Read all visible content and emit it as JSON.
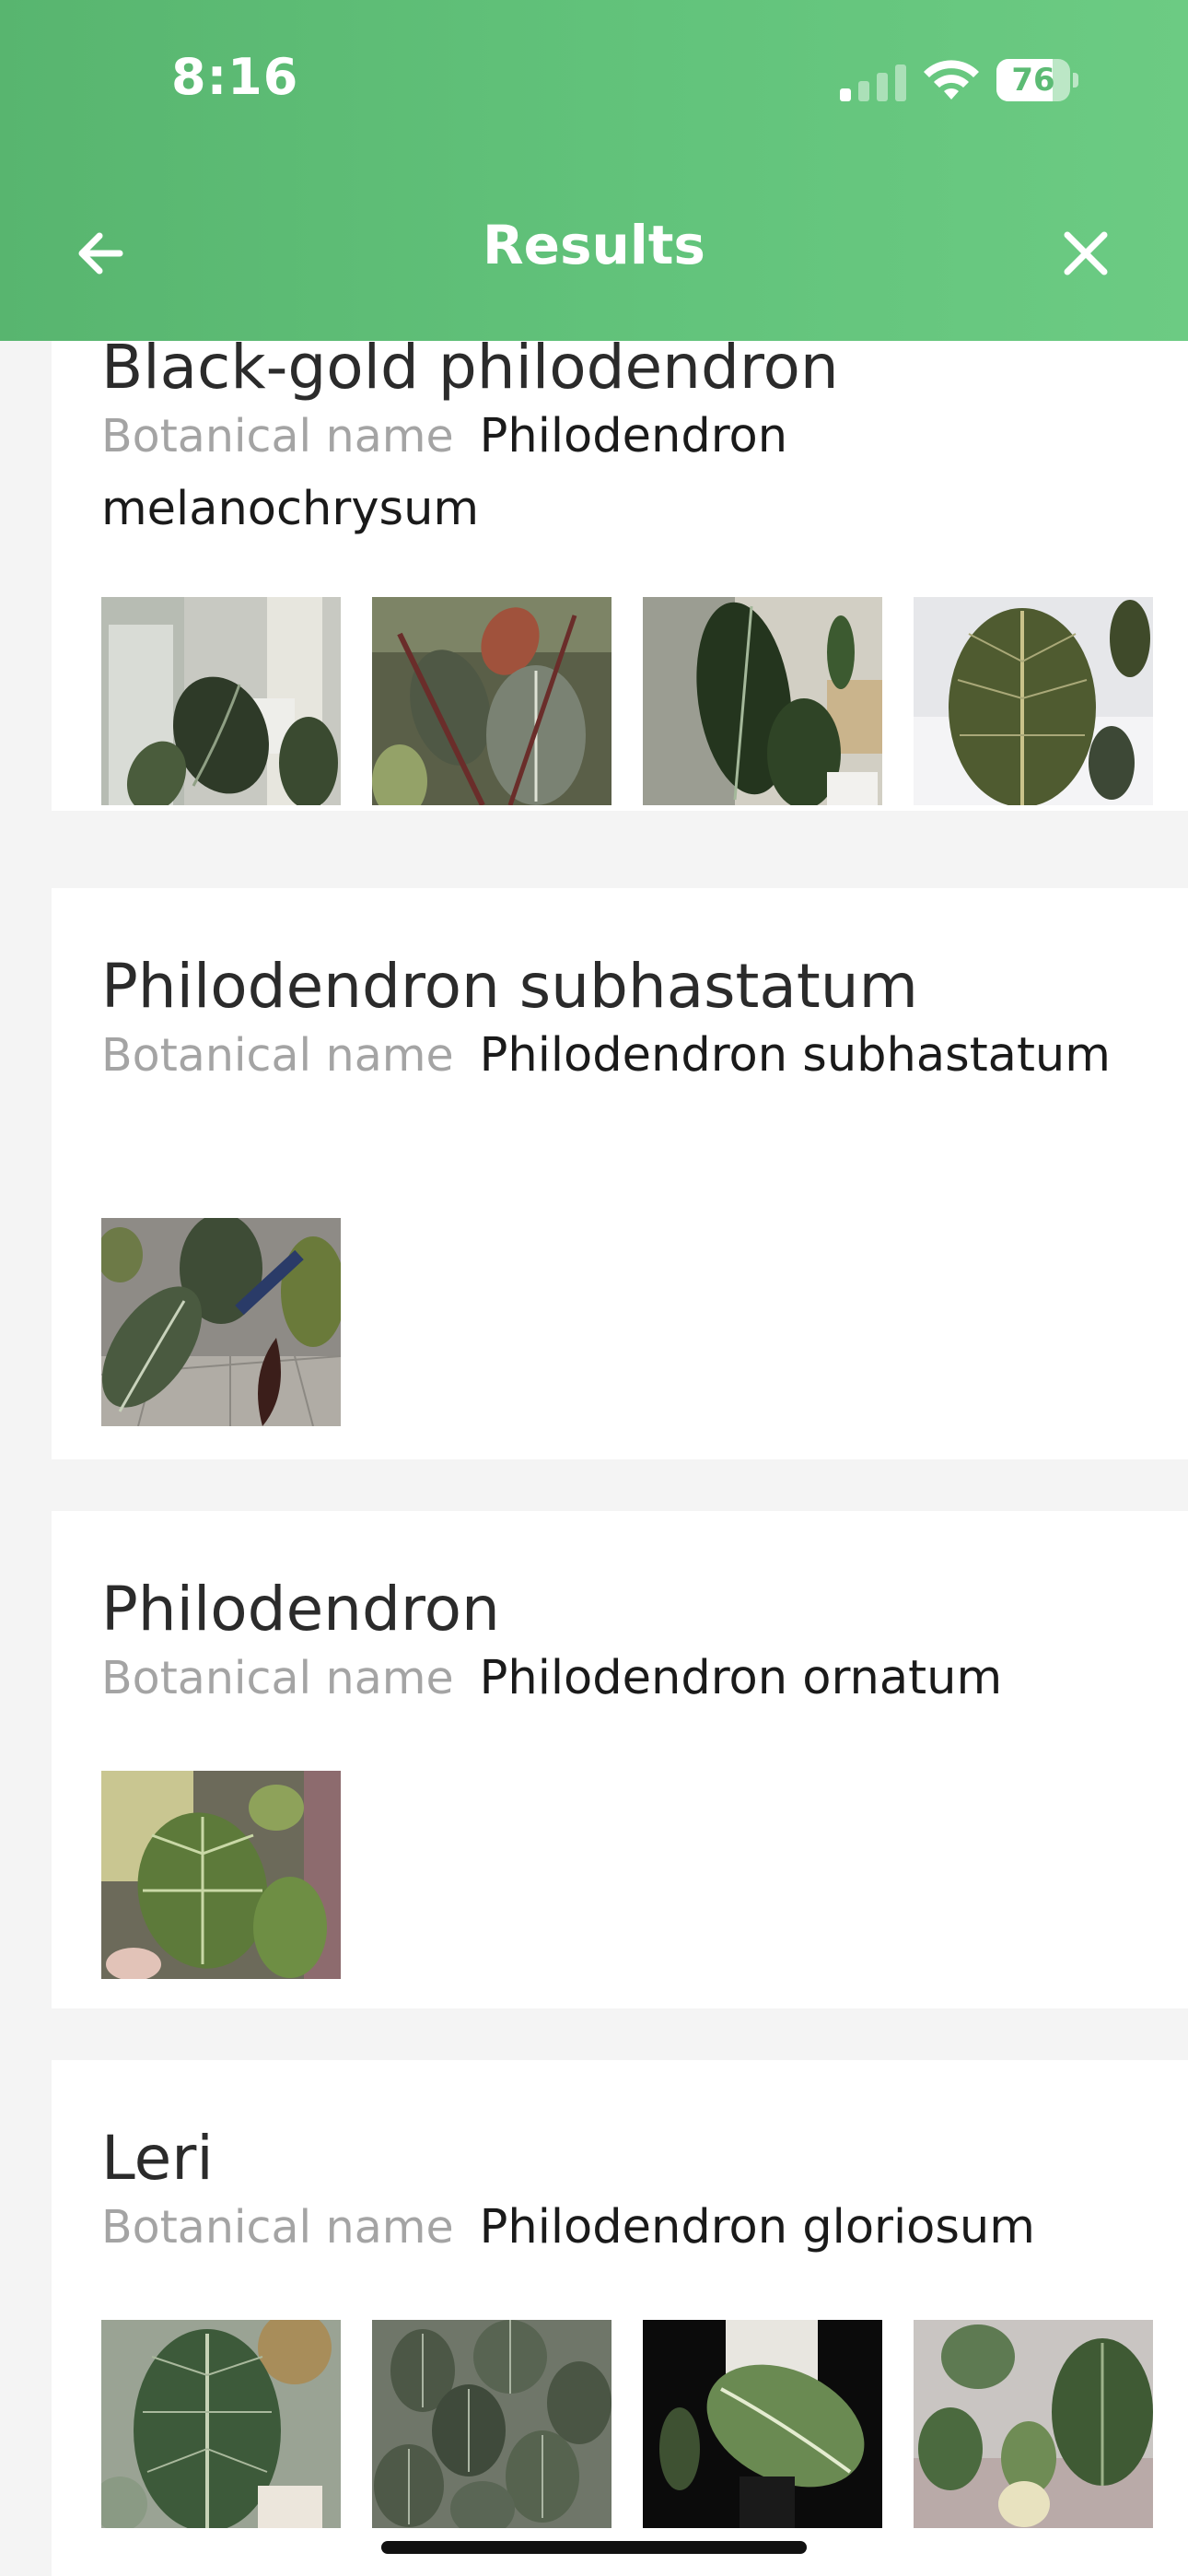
{
  "status_bar": {
    "time": "8:16",
    "battery_level": 76,
    "battery_text": "76",
    "signal_bars_active": 1
  },
  "nav": {
    "title": "Results",
    "back_icon": "arrow-left-icon",
    "close_icon": "close-icon"
  },
  "colors": {
    "header_green": "#62c37b",
    "page_background": "#f4f4f4",
    "card_background": "#ffffff",
    "label_gray": "#a4a4a4"
  },
  "results": [
    {
      "name": "Black-gold philodendron",
      "botanical_label": "Botanical name",
      "botanical_name": "Philodendron melanochrysum",
      "photo_count": 4
    },
    {
      "name": "Philodendron subhastatum",
      "botanical_label": "Botanical name",
      "botanical_name": "Philodendron subhastatum",
      "photo_count": 1
    },
    {
      "name": "Philodendron",
      "botanical_label": "Botanical name",
      "botanical_name": "Philodendron ornatum",
      "photo_count": 1
    },
    {
      "name": "Leri",
      "botanical_label": "Botanical name",
      "botanical_name": "Philodendron gloriosum",
      "photo_count": 4
    }
  ]
}
